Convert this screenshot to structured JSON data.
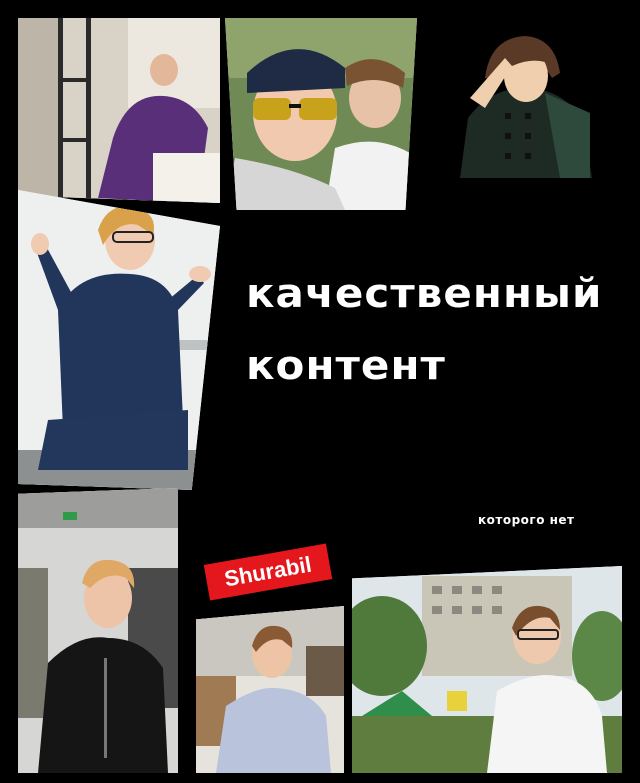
{
  "title_lines": [
    "качественный",
    "контент"
  ],
  "subtitle": "которого нет",
  "logo_text": "Shurabil",
  "colors": {
    "background": "#000000",
    "text": "#ffffff",
    "logo_bg": "#e4171c"
  },
  "icons": {
    "avatar": "anime-character-saluting"
  }
}
